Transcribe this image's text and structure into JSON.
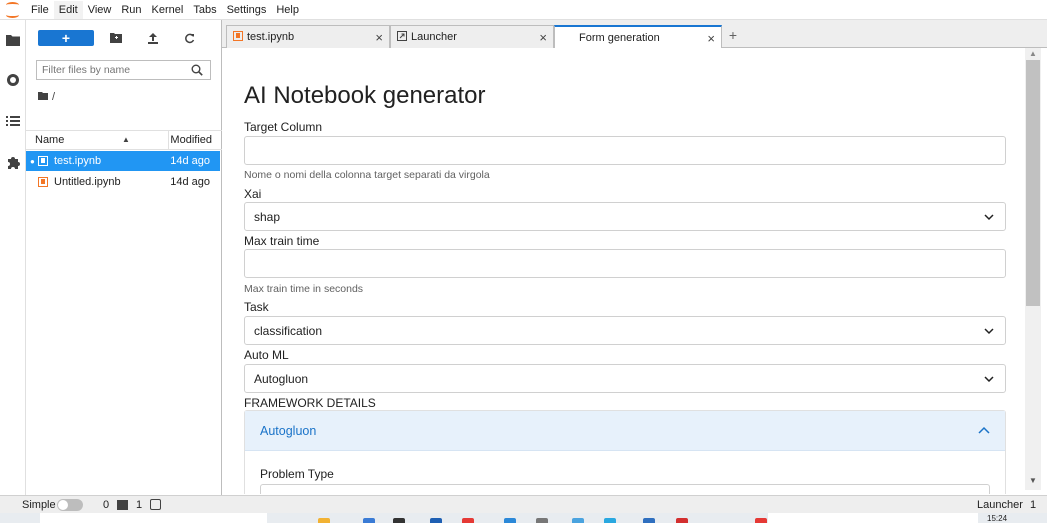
{
  "menubar": {
    "items": [
      "File",
      "Edit",
      "View",
      "Run",
      "Kernel",
      "Tabs",
      "Settings",
      "Help"
    ],
    "active_item": "Edit"
  },
  "activity_bar": {
    "icons": [
      "folder-icon",
      "running-icon",
      "toc-icon",
      "extension-icon"
    ]
  },
  "file_browser": {
    "new_button_label": "+",
    "filter_placeholder": "Filter files by name",
    "breadcrumb": "/",
    "column_name": "Name",
    "column_modified": "Modified",
    "files": [
      {
        "name": "test.ipynb",
        "modified": "14d ago",
        "selected": true,
        "running": true
      },
      {
        "name": "Untitled.ipynb",
        "modified": "14d ago",
        "selected": false,
        "running": false
      }
    ]
  },
  "tabs": [
    {
      "label": "test.ipynb",
      "icon": "notebook-icon",
      "active": false
    },
    {
      "label": "Launcher",
      "icon": "launcher-icon",
      "active": false
    },
    {
      "label": "Form generation",
      "icon": "",
      "active": true
    }
  ],
  "form": {
    "title": "AI Notebook generator",
    "target_column": {
      "label": "Target Column",
      "value": "",
      "help": "Nome o nomi della colonna target separati da virgola"
    },
    "xai": {
      "label": "Xai",
      "value": "shap"
    },
    "max_train_time": {
      "label": "Max train time",
      "value": "",
      "help": "Max train time in seconds"
    },
    "task": {
      "label": "Task",
      "value": "classification"
    },
    "auto_ml": {
      "label": "Auto ML",
      "value": "Autogluon"
    },
    "framework_details": {
      "label": "FRAMEWORK DETAILS",
      "section_title": "Autogluon",
      "problem_type_label": "Problem Type"
    }
  },
  "statusbar": {
    "simple_label": "Simple",
    "terminals_count": "0",
    "kernels_count": "1",
    "mode": "Launcher",
    "tab_count": "1"
  },
  "taskbar": {
    "time": "15:24"
  },
  "colors": {
    "accent": "#1976d2",
    "selected_row": "#2196f3",
    "notebook_icon": "#f37626",
    "accordion_bg": "#e7f1fb",
    "accordion_text": "#1a73c8"
  }
}
